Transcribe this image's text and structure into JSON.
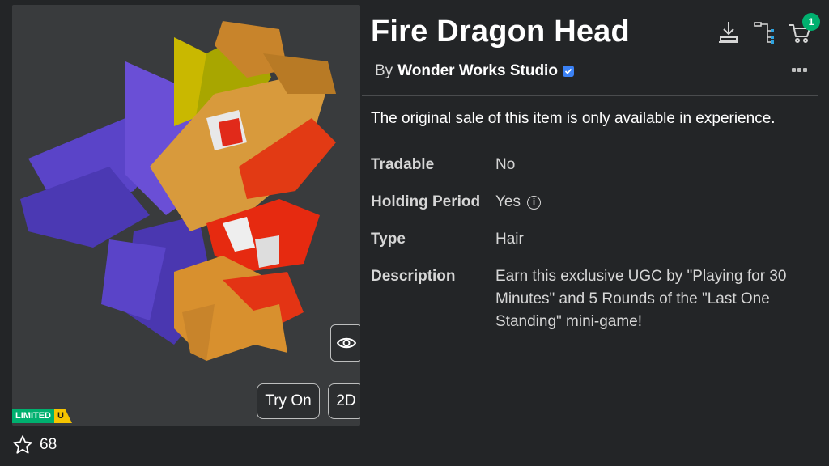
{
  "item": {
    "title": "Fire Dragon Head",
    "by_label": "By",
    "creator": "Wonder Works Studio",
    "sale_note": "The original sale of this item is only available in experience.",
    "badge_limited": "LIMITED",
    "badge_u": "U",
    "favorites": "68"
  },
  "buttons": {
    "try_on": "Try On",
    "two_d": "2D"
  },
  "cart": {
    "count": "1"
  },
  "details": [
    {
      "label": "Tradable",
      "value": "No"
    },
    {
      "label": "Holding Period",
      "value": "Yes"
    },
    {
      "label": "Type",
      "value": "Hair"
    },
    {
      "label": "Description",
      "value": "Earn this exclusive UGC by \"Playing for 30 Minutes\" and 5 Rounds of the \"Last One Standing\" mini-game!"
    }
  ],
  "icons": {
    "download": "download-icon",
    "structure": "hierarchy-icon",
    "cart": "cart-icon",
    "more": "more-icon",
    "view": "eye-icon",
    "star": "star-icon",
    "verified": "verified-badge-icon",
    "info": "info-icon"
  },
  "colors": {
    "background": "#232527",
    "panel": "#393b3d",
    "limited_green": "#00b06f",
    "limited_yellow": "#f5c400",
    "verified_blue": "#3b82f6"
  }
}
